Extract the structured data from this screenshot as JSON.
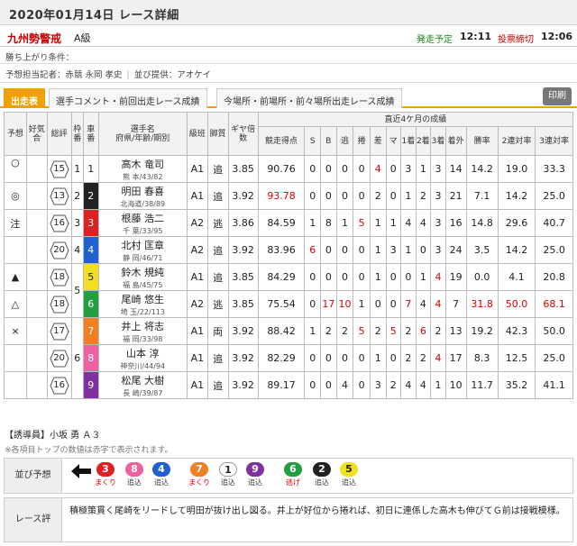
{
  "header": {
    "title": "2020年01月14日 レース詳細"
  },
  "race": {
    "name": "九州勢警戒",
    "grade": "A級",
    "start_label": "発走予定",
    "start_time": "12:11",
    "close_label": "投票締切",
    "close_time": "12:06"
  },
  "info": {
    "condition": "勝ち上がり条件：",
    "forecaster": "予想担当記者：赤競 永岡 孝史",
    "provider": "並び提供：アオケイ"
  },
  "tabs": [
    "出走表",
    "選手コメント・前回出走レース成績",
    "今場所・前場所・前々場所出走レース成績"
  ],
  "print_label": "印刷",
  "colors": {
    "accent": "#f0a000",
    "red": "#d00000"
  },
  "table": {
    "headers": {
      "yoso": "予想",
      "kokiai": "好気合",
      "sohyo": "総評",
      "waku": "枠番",
      "sha": "車番",
      "name": "選手名",
      "pref": "府県/年齢/期別",
      "kyu": "級班",
      "kyaku": "脚質",
      "gear": "ギヤ倍数",
      "recent": "直近4ケ月の成績",
      "score": "競走得点",
      "s": "S",
      "b": "B",
      "nige": "逃",
      "makuri": "捲",
      "sashi": "差",
      "ma": "マ",
      "first": "1着",
      "second": "2着",
      "third": "3着",
      "outside": "着外",
      "win": "勝率",
      "ren2": "2連対率",
      "ren3": "3連対率"
    },
    "waku_groups": [
      "1",
      "2",
      "3",
      "4",
      "5",
      "6"
    ],
    "rows": [
      {
        "mark": "○",
        "kokiai": "",
        "sohyo": "15",
        "sha": "1",
        "sha_bg": "#ffffff",
        "sha_fg": "#222222",
        "name": "高木 竜司",
        "pref": "熊 本/43/82",
        "kyu": "A1",
        "kyaku": "追",
        "gear": "3.85",
        "score": "90.76",
        "s": "0",
        "b": "0",
        "nige": "0",
        "makuri": "0",
        "sashi": "4",
        "ma": "0",
        "first": "3",
        "second": "1",
        "third": "3",
        "outside": "14",
        "win": "14.2",
        "ren2": "19.0",
        "ren3": "33.3"
      },
      {
        "mark": "◎",
        "kokiai": "",
        "sohyo": "13",
        "sha": "2",
        "sha_bg": "#222222",
        "sha_fg": "#ffffff",
        "name": "明田 春喜",
        "pref": "北海道/38/89",
        "kyu": "A1",
        "kyaku": "追",
        "gear": "3.92",
        "score": "93.78",
        "s": "0",
        "b": "0",
        "nige": "0",
        "makuri": "0",
        "sashi": "2",
        "ma": "0",
        "first": "1",
        "second": "2",
        "third": "3",
        "outside": "21",
        "win": "7.1",
        "ren2": "14.2",
        "ren3": "25.0"
      },
      {
        "mark": "注",
        "kokiai": "",
        "sohyo": "16",
        "sha": "3",
        "sha_bg": "#e02020",
        "sha_fg": "#ffffff",
        "name": "根藤 浩二",
        "pref": "千 葉/33/95",
        "kyu": "A2",
        "kyaku": "逃",
        "gear": "3.86",
        "score": "84.59",
        "s": "1",
        "b": "8",
        "nige": "1",
        "makuri": "5",
        "sashi": "1",
        "ma": "1",
        "first": "4",
        "second": "4",
        "third": "3",
        "outside": "16",
        "win": "14.8",
        "ren2": "29.6",
        "ren3": "40.7"
      },
      {
        "mark": "",
        "kokiai": "",
        "sohyo": "20",
        "sha": "4",
        "sha_bg": "#2060d0",
        "sha_fg": "#ffffff",
        "name": "北村 匡章",
        "pref": "静 岡/46/71",
        "kyu": "A2",
        "kyaku": "追",
        "gear": "3.92",
        "score": "83.96",
        "s": "6",
        "b": "0",
        "nige": "0",
        "makuri": "0",
        "sashi": "1",
        "ma": "3",
        "first": "1",
        "second": "0",
        "third": "3",
        "outside": "24",
        "win": "3.5",
        "ren2": "14.2",
        "ren3": "25.0"
      },
      {
        "mark": "▲",
        "kokiai": "",
        "sohyo": "18",
        "sha": "5",
        "sha_bg": "#f0e020",
        "sha_fg": "#222222",
        "name": "鈴木 規純",
        "pref": "福 島/45/75",
        "kyu": "A1",
        "kyaku": "追",
        "gear": "3.85",
        "score": "84.29",
        "s": "0",
        "b": "0",
        "nige": "0",
        "makuri": "0",
        "sashi": "1",
        "ma": "0",
        "first": "0",
        "second": "1",
        "third": "4",
        "outside": "19",
        "win": "0.0",
        "ren2": "4.1",
        "ren3": "20.8"
      },
      {
        "mark": "△",
        "kokiai": "",
        "sohyo": "18",
        "sha": "6",
        "sha_bg": "#20a040",
        "sha_fg": "#ffffff",
        "name": "尾崎 悠生",
        "pref": "埼 玉/22/113",
        "kyu": "A2",
        "kyaku": "逃",
        "gear": "3.85",
        "score": "75.54",
        "s": "0",
        "b": "17",
        "nige": "10",
        "makuri": "1",
        "sashi": "0",
        "ma": "0",
        "first": "7",
        "second": "4",
        "third": "4",
        "outside": "7",
        "win": "31.8",
        "ren2": "50.0",
        "ren3": "68.1"
      },
      {
        "mark": "×",
        "kokiai": "",
        "sohyo": "17",
        "sha": "7",
        "sha_bg": "#f08020",
        "sha_fg": "#ffffff",
        "name": "井上 将志",
        "pref": "福 岡/33/98",
        "kyu": "A1",
        "kyaku": "両",
        "gear": "3.92",
        "score": "88.42",
        "s": "1",
        "b": "2",
        "nige": "2",
        "makuri": "5",
        "sashi": "2",
        "ma": "5",
        "first": "2",
        "second": "6",
        "third": "2",
        "outside": "13",
        "win": "19.2",
        "ren2": "42.3",
        "ren3": "50.0"
      },
      {
        "mark": "",
        "kokiai": "",
        "sohyo": "20",
        "sha": "8",
        "sha_bg": "#f060a0",
        "sha_fg": "#ffffff",
        "name": "山本 淳",
        "pref": "神奈川/44/94",
        "kyu": "A1",
        "kyaku": "追",
        "gear": "3.92",
        "score": "82.29",
        "s": "0",
        "b": "0",
        "nige": "0",
        "makuri": "0",
        "sashi": "1",
        "ma": "0",
        "first": "2",
        "second": "2",
        "third": "4",
        "outside": "17",
        "win": "8.3",
        "ren2": "12.5",
        "ren3": "25.0"
      },
      {
        "mark": "",
        "kokiai": "",
        "sohyo": "16",
        "sha": "9",
        "sha_bg": "#8030a0",
        "sha_fg": "#ffffff",
        "name": "松尾 大樹",
        "pref": "長 崎/39/87",
        "kyu": "A1",
        "kyaku": "追",
        "gear": "3.92",
        "score": "89.17",
        "s": "0",
        "b": "0",
        "nige": "4",
        "makuri": "0",
        "sashi": "3",
        "ma": "2",
        "first": "4",
        "second": "4",
        "third": "1",
        "outside": "10",
        "win": "11.7",
        "ren2": "35.2",
        "ren3": "41.1"
      }
    ]
  },
  "leader": "【誘導員】小坂 勇 Ａ３",
  "note": "※各項目トップの数値は赤字で表示されます。",
  "prediction": {
    "label": "並び予想",
    "arrow_icon": "arrow-left-icon",
    "chips": [
      {
        "num": "3",
        "bg": "#e02020",
        "fg": "#ffffff",
        "sub": "まくり",
        "sub_red": true
      },
      {
        "num": "8",
        "bg": "#f060a0",
        "fg": "#ffffff",
        "sub": "追込",
        "sub_red": false
      },
      {
        "num": "4",
        "bg": "#2060d0",
        "fg": "#ffffff",
        "sub": "追込",
        "sub_red": false
      },
      {
        "num": "7",
        "bg": "#f08020",
        "fg": "#ffffff",
        "sub": "まくり",
        "sub_red": true
      },
      {
        "num": "1",
        "bg": "#ffffff",
        "fg": "#222222",
        "sub": "追込",
        "sub_red": false
      },
      {
        "num": "9",
        "bg": "#8030a0",
        "fg": "#ffffff",
        "sub": "追込",
        "sub_red": false
      },
      {
        "num": "6",
        "bg": "#20a040",
        "fg": "#ffffff",
        "sub": "逃げ",
        "sub_red": true
      },
      {
        "num": "2",
        "bg": "#222222",
        "fg": "#ffffff",
        "sub": "追込",
        "sub_red": false
      },
      {
        "num": "5",
        "bg": "#f0e020",
        "fg": "#222222",
        "sub": "追込",
        "sub_red": false
      }
    ]
  },
  "review": {
    "label": "レース評",
    "text": "積極策貫く尾崎をリードして明田が抜け出し図る。井上が好位から捲れば、初日に連係した高木も伸びてＧ前は接戦模様。"
  }
}
